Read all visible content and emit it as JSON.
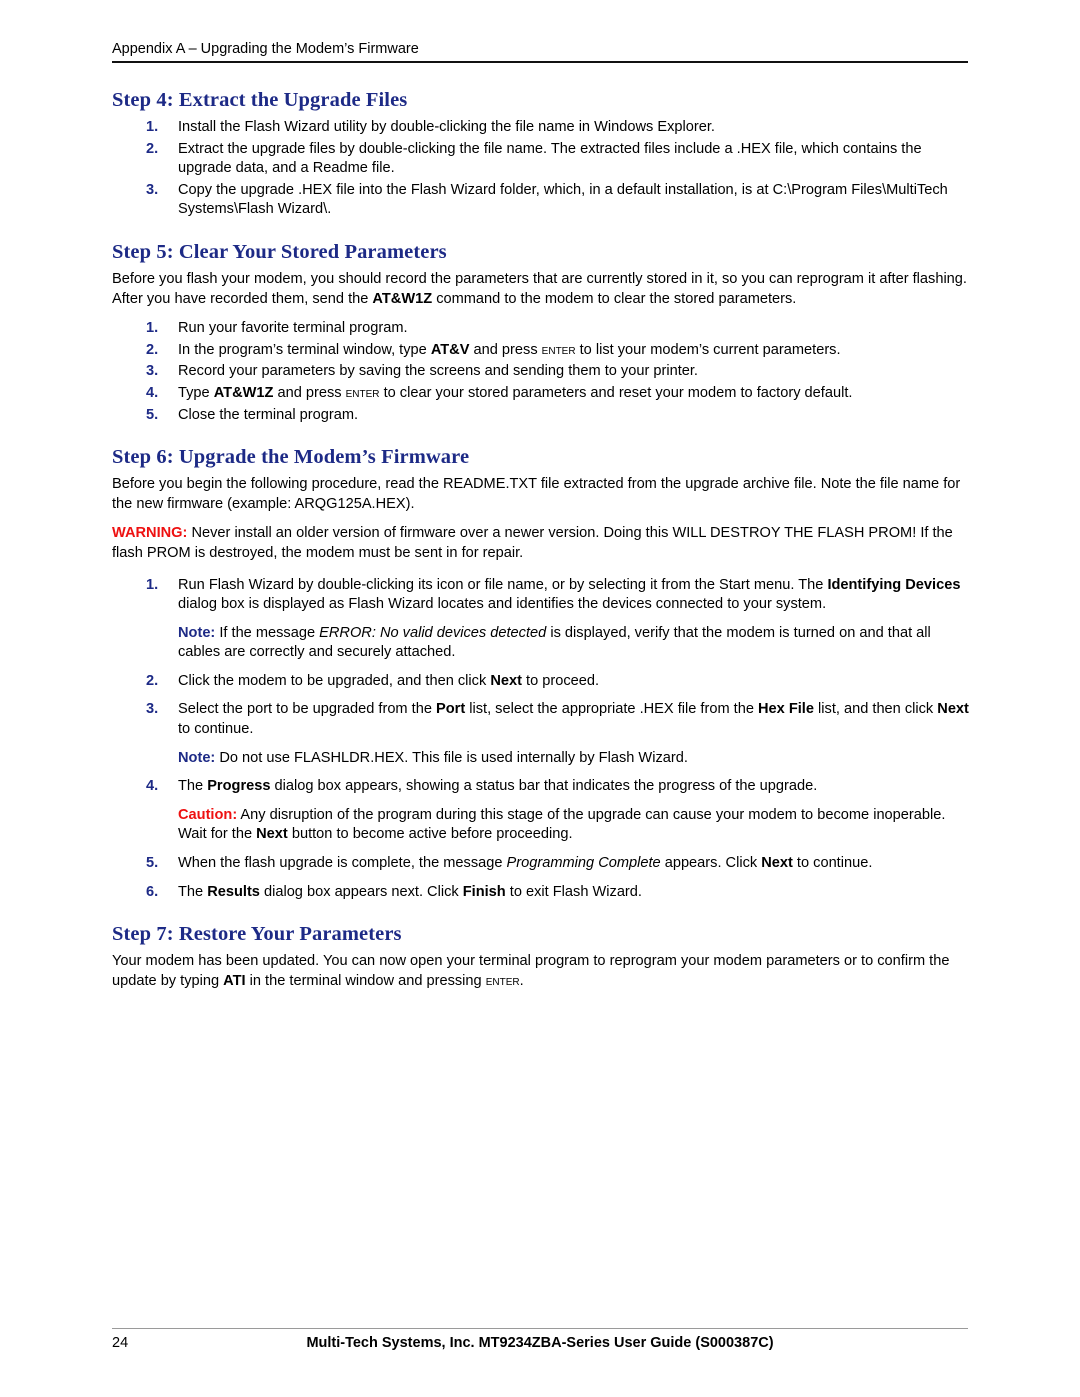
{
  "header": {
    "text": "Appendix A – Upgrading the Modem’s Firmware"
  },
  "footer": {
    "page_number": "24",
    "center_text": "Multi-Tech Systems, Inc. MT9234ZBA-Series User Guide (S000387C)"
  },
  "colors": {
    "heading_navy": "#1d2a86",
    "warning_red": "#ee1111",
    "body_black": "#000000"
  },
  "sections": {
    "step4": {
      "heading": "Step 4: Extract the Upgrade Files",
      "items": [
        {
          "num": "1.",
          "parts": [
            {
              "t": "Install the Flash Wizard utility by double-clicking the file name in Windows Explorer."
            }
          ]
        },
        {
          "num": "2.",
          "parts": [
            {
              "t": "Extract the upgrade files by double-clicking the file name. The extracted files include a .HEX file, which contains the upgrade data, and a Readme file."
            }
          ]
        },
        {
          "num": "3.",
          "parts": [
            {
              "t": "Copy the upgrade .HEX file into the Flash Wizard folder, which, in a default installation, is at C:\\Program Files\\MultiTech Systems\\Flash Wizard\\."
            }
          ]
        }
      ]
    },
    "step5": {
      "heading": "Step 5: Clear Your Stored Parameters",
      "intro_a": "Before you flash your modem, you should record the parameters that are currently stored in it, so you can reprogram it after flashing. After you have recorded them, send the ",
      "intro_cmd": "AT&W1Z",
      "intro_b": " command to the modem to clear the stored parameters.",
      "items": [
        {
          "num": "1.",
          "text": "Run your favorite terminal program."
        },
        {
          "num": "2.",
          "pre": "In the program’s terminal window, type ",
          "cmd": "AT&V",
          "mid": " and press ",
          "key": "Enter",
          "post": " to list your modem’s current parameters."
        },
        {
          "num": "3.",
          "text": "Record your parameters by saving the screens and sending them to your printer."
        },
        {
          "num": "4.",
          "pre": "Type ",
          "cmd": "AT&W1Z",
          "mid": " and press ",
          "key": "Enter",
          "post": " to clear your stored parameters and reset your modem to factory default."
        },
        {
          "num": "5.",
          "text": "Close the terminal program."
        }
      ]
    },
    "step6": {
      "heading": "Step 6: Upgrade the Modem’s Firmware",
      "intro": "Before you begin the following procedure, read the README.TXT file extracted from the upgrade archive file. Note the file name for the new firmware (example: ARQG125A.HEX).",
      "warning_label": "WARNING:",
      "warning_text": " Never install an older version of firmware over a newer version. Doing this WILL DESTROY THE FLASH PROM! If the flash PROM is destroyed, the modem must be sent in for repair.",
      "item1": {
        "num": "1.",
        "a": "Run Flash Wizard by double-clicking its icon or file name, or by selecting it from the Start menu. The ",
        "b1": "Identifying Devices",
        "b": " dialog box is displayed as Flash Wizard locates and identifies the devices connected to your system."
      },
      "note1": {
        "label": "Note:",
        "a": " If the message ",
        "italic": "ERROR: No valid devices detected",
        "b": " is displayed, verify that the modem is turned on and that all cables are correctly and securely attached."
      },
      "item2": {
        "num": "2.",
        "a": "Click the modem to be upgraded, and then click ",
        "b1": "Next",
        "b": " to proceed."
      },
      "item3": {
        "num": "3.",
        "a": "Select the port to be upgraded from the ",
        "b1": "Port",
        "b": " list, select the appropriate .HEX file from the ",
        "b2": "Hex File",
        "c": " list, and then click ",
        "b3": "Next",
        "d": " to continue."
      },
      "note2": {
        "label": "Note:",
        "text": " Do not use FLASHLDR.HEX. This file is used internally by Flash Wizard."
      },
      "item4": {
        "num": "4.",
        "a": "The ",
        "b1": "Progress",
        "b": " dialog box appears, showing a status bar that indicates the progress of the upgrade."
      },
      "caution": {
        "label": "Caution:",
        "a": " Any disruption of the program during this stage of the upgrade can cause your modem to become inoperable. Wait for the ",
        "b1": "Next",
        "b": " button to become active before proceeding."
      },
      "item5": {
        "num": "5.",
        "a": "When the flash upgrade is complete, the message ",
        "italic": "Programming Complete",
        "b": " appears. Click ",
        "b1": "Next",
        "c": " to continue."
      },
      "item6": {
        "num": "6.",
        "a": "The ",
        "b1": "Results",
        "b": " dialog box appears next. Click ",
        "b2": "Finish",
        "c": " to exit Flash Wizard."
      }
    },
    "step7": {
      "heading": "Step 7: Restore Your Parameters",
      "a": "Your modem has been updated. You can now open your terminal program to reprogram your modem parameters or to confirm the update by typing ",
      "cmd": "ATI",
      "b": " in the terminal window and pressing ",
      "key": "Enter",
      "c": "."
    }
  }
}
